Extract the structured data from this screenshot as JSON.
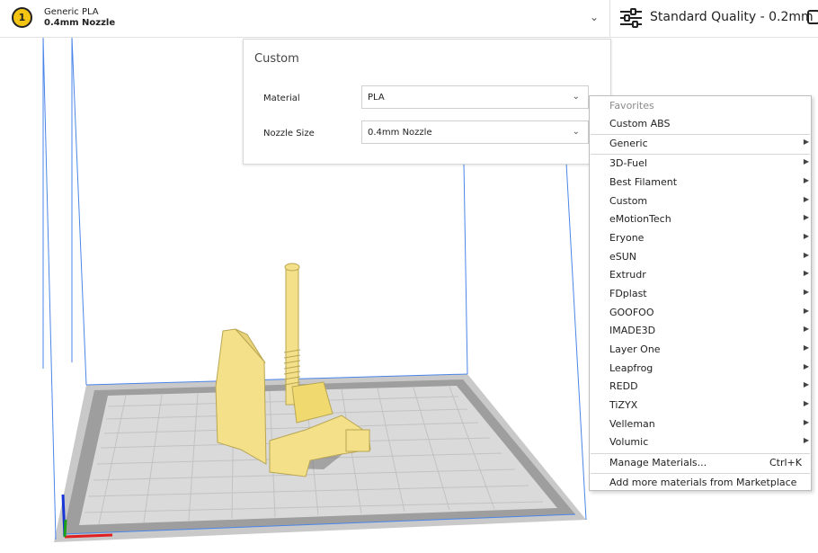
{
  "extruder": {
    "number": "1",
    "material": "Generic PLA",
    "nozzle": "0.4mm Nozzle"
  },
  "quality": {
    "label": "Standard Quality - 0.2mm",
    "icon": "sliders-icon"
  },
  "panel": {
    "title": "Custom",
    "material_label": "Material",
    "material_value": "PLA",
    "nozzle_label": "Nozzle Size",
    "nozzle_value": "0.4mm Nozzle"
  },
  "menu": {
    "favorites_header": "Favorites",
    "favorites": [
      "Custom ABS"
    ],
    "generic": "Generic",
    "brands": [
      "3D-Fuel",
      "Best Filament",
      "Custom",
      "eMotionTech",
      "Eryone",
      "eSUN",
      "Extrudr",
      "FDplast",
      "GOOFOO",
      "IMADE3D",
      "Layer One",
      "Leapfrog",
      "REDD",
      "TiZYX",
      "Velleman",
      "Volumic"
    ],
    "manage": "Manage Materials...",
    "manage_shortcut": "Ctrl+K",
    "marketplace": "Add more materials from Marketplace"
  },
  "colors": {
    "accent_yellow": "#f3c411",
    "model": "#f3e089",
    "build_volume_line": "#4a86e8",
    "plate": "#d9d9d9"
  }
}
